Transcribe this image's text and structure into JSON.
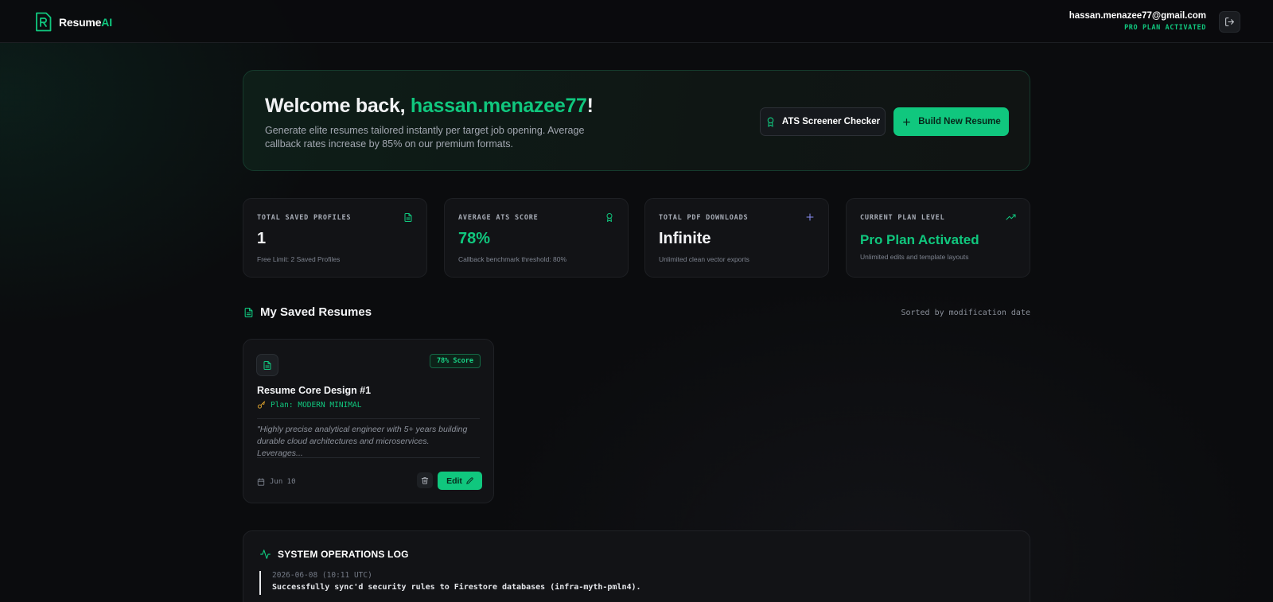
{
  "app": {
    "brand_prefix": "Resume",
    "brand_suffix": "AI"
  },
  "user": {
    "email": "hassan.menazee77@gmail.com",
    "plan_status": "PRO PLAN ACTIVATED"
  },
  "welcome": {
    "greeting": "Welcome back, ",
    "username": "hassan.menazee77",
    "exclaim": "!",
    "subtitle": "Generate elite resumes tailored instantly per target job opening. Average callback rates increase by 85% on our premium formats.",
    "ats_button": "ATS Screener Checker",
    "build_button": "Build New Resume"
  },
  "stats": [
    {
      "label": "TOTAL SAVED PROFILES",
      "value": "1",
      "note": "Free Limit: 2 Saved Profiles",
      "icon": "document-icon"
    },
    {
      "label": "AVERAGE ATS SCORE",
      "value": "78%",
      "note": "Callback benchmark threshold: 80%",
      "icon": "award-icon"
    },
    {
      "label": "TOTAL PDF DOWNLOADS",
      "value": "Infinite",
      "note": "Unlimited clean vector exports",
      "icon": "plus-icon"
    },
    {
      "label": "CURRENT PLAN LEVEL",
      "value": "Pro Plan Activated",
      "note": "Unlimited edits and template layouts",
      "icon": "trending-up-icon"
    }
  ],
  "saved_resumes": {
    "title": "My Saved Resumes",
    "sort_label": "Sorted by modification date",
    "items": [
      {
        "title": "Resume Core Design #1",
        "score_badge": "78% Score",
        "plan_prefix": "Plan:",
        "plan_value": "MODERN MINIMAL",
        "description": "\"Highly precise analytical engineer with 5+ years building durable cloud architectures and microservices. Leverages...",
        "date": "Jun 10",
        "edit_label": "Edit"
      }
    ]
  },
  "log": {
    "title": "SYSTEM OPERATIONS LOG",
    "entries": [
      {
        "time": "2026-06-08 (10:11 UTC)",
        "message": "Successfully sync'd security rules to Firestore databases (infra-myth-pmln4)."
      }
    ]
  },
  "colors": {
    "accent": "#10c77e",
    "background": "#0b0c0e",
    "card": "#121316",
    "plan_icon": "#d39c2d"
  }
}
